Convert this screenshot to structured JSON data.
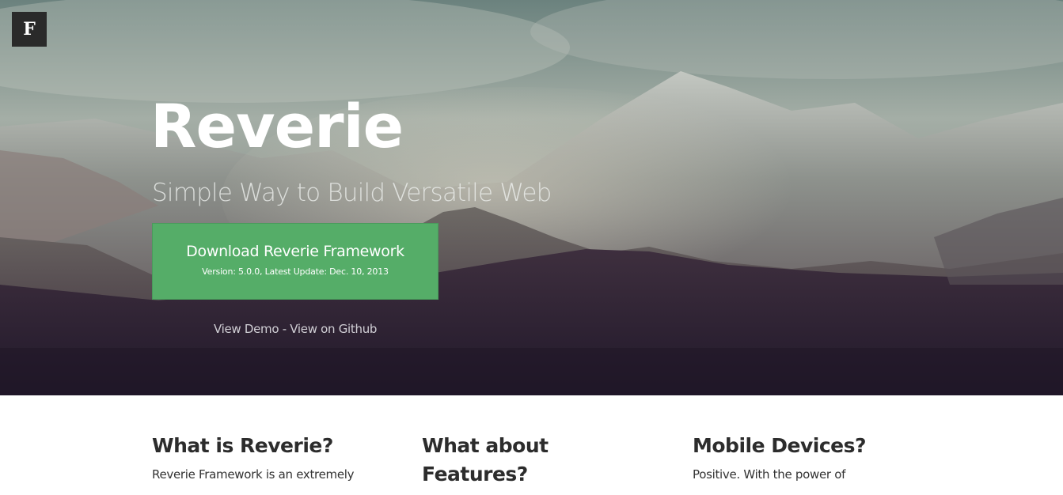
{
  "header": {
    "logo_letter": "F"
  },
  "hero": {
    "title": "Reverie",
    "subtitle": "Simple Way to Build Versatile Web",
    "download": {
      "label": "Download Reverie Framework",
      "meta": "Version: 5.0.0, Latest Update: Dec. 10, 2013",
      "color": "#55ad68"
    },
    "links": {
      "demo": "View Demo",
      "separator": " - ",
      "github": "View on Github"
    }
  },
  "features": {
    "columns": [
      {
        "heading": "What is Reverie?",
        "text": "Reverie Framework is an extremely"
      },
      {
        "heading_line1": "What about",
        "heading_line2": "Features?"
      },
      {
        "heading": "Mobile Devices?",
        "text": "Positive. With the power of"
      }
    ]
  }
}
